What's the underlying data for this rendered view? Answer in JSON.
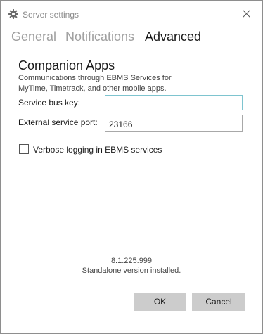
{
  "window": {
    "title": "Server settings",
    "title_icon": "gear-icon",
    "close_icon": "close-icon"
  },
  "tabs": [
    {
      "label": "General",
      "active": false
    },
    {
      "label": "Notifications",
      "active": false
    },
    {
      "label": "Advanced",
      "active": true
    }
  ],
  "section": {
    "title": "Companion Apps",
    "description": "Communications through EBMS Services for MyTime, Timetrack, and other mobile apps."
  },
  "fields": {
    "service_bus_key": {
      "label": "Service bus key:",
      "value": ""
    },
    "external_service_port": {
      "label": "External service port:",
      "value": "23166"
    }
  },
  "verbose_logging": {
    "label": "Verbose logging in EBMS services",
    "checked": false
  },
  "footer": {
    "version": "8.1.225.999",
    "install_note": "Standalone version installed."
  },
  "buttons": {
    "ok_label": "OK",
    "cancel_label": "Cancel"
  },
  "colors": {
    "focus_border": "#7ec4cf",
    "button_bg": "#cccccc",
    "inactive_tab": "#a0a0a0"
  }
}
